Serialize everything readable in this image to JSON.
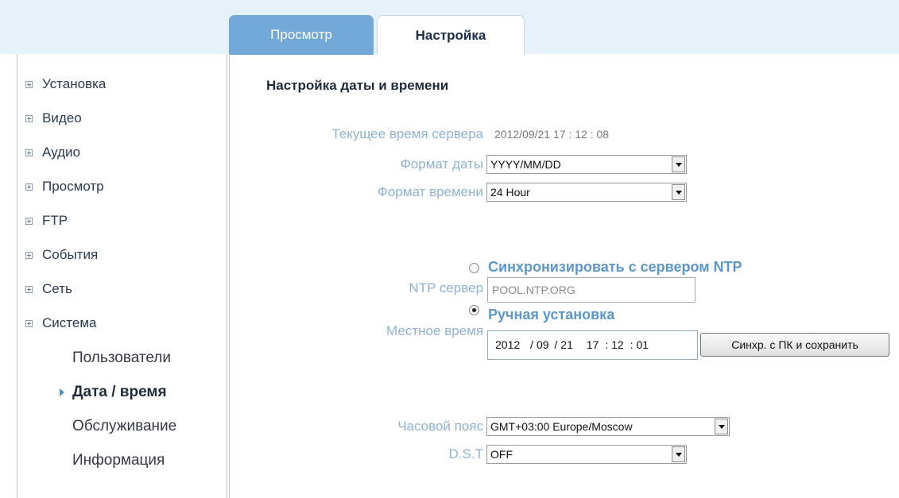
{
  "tabs": {
    "view": "Просмотр",
    "settings": "Настройка"
  },
  "sidebar": {
    "items": [
      "Установка",
      "Видео",
      "Аудио",
      "Просмотр",
      "FTP",
      "События",
      "Сеть",
      "Система"
    ],
    "subitems": [
      "Пользователи",
      "Дата / время",
      "Обслуживание",
      "Информация"
    ],
    "active_subitem": "Дата / время"
  },
  "main": {
    "title": "Настройка даты и времени",
    "server_time_label": "Текущее время сервера",
    "server_time_value": "2012/09/21   17 : 12 : 08",
    "date_format_label": "Формат даты",
    "date_format_value": "YYYY/MM/DD",
    "time_format_label": "Формат времени",
    "time_format_value": "24 Hour",
    "ntp_sync_label": "Синхронизировать с сервером NTP",
    "ntp_server_label": "NTP сервер",
    "ntp_server_value": "POOL.NTP.ORG",
    "manual_label": "Ручная установка",
    "local_time_label": "Местное время",
    "local_time": {
      "year": "2012",
      "month": "09",
      "day": "21",
      "hour": "17",
      "minute": "12",
      "second": "01"
    },
    "sync_button": "Синхр. с ПК и сохранить",
    "timezone_label": "Часовой пояс",
    "timezone_value": "GMT+03:00 Europe/Moscow",
    "dst_label": "D.S.T",
    "dst_value": "OFF",
    "selected_mode": "manual"
  },
  "colors": {
    "label": "#8fb2d5",
    "tab_active_bg": "#ffffff",
    "tab_inactive_bg": "#73a9d8",
    "radio_label": "#5c97cc"
  }
}
